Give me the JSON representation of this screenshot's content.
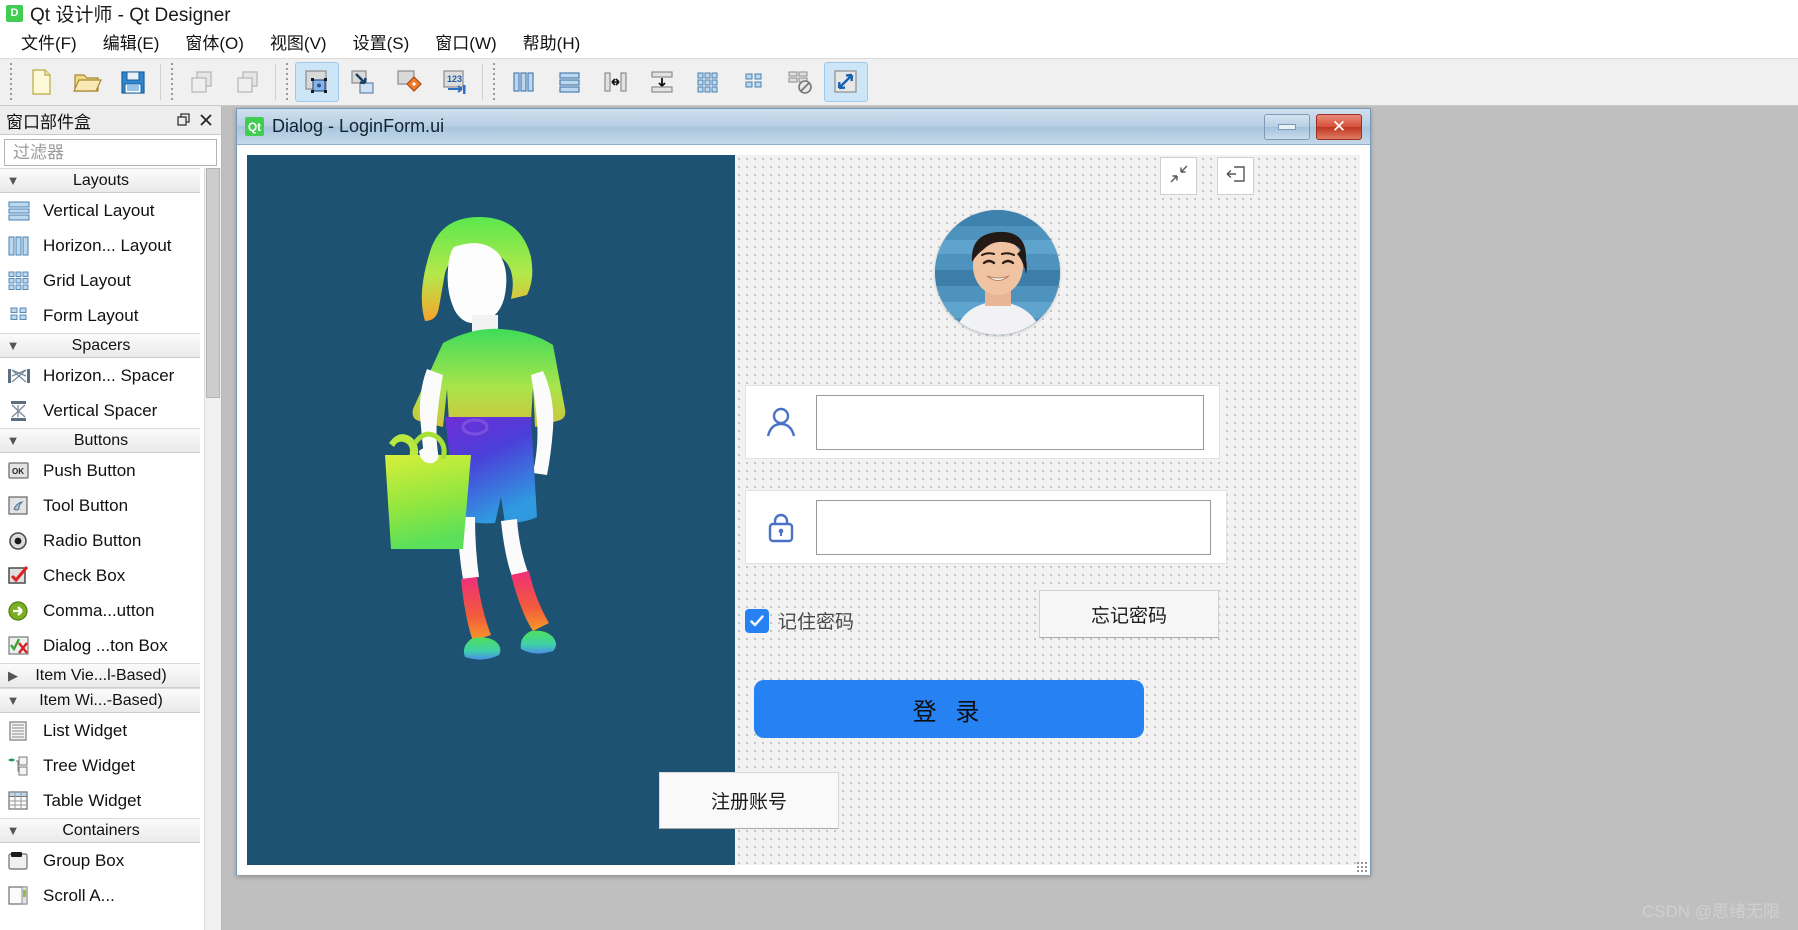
{
  "app": {
    "title": "Qt 设计师 - Qt Designer",
    "logo_text": "D",
    "menus": [
      {
        "label": "文件(F)",
        "name": "menu-file"
      },
      {
        "label": "编辑(E)",
        "name": "menu-edit"
      },
      {
        "label": "窗体(O)",
        "name": "menu-form"
      },
      {
        "label": "视图(V)",
        "name": "menu-view"
      },
      {
        "label": "设置(S)",
        "name": "menu-settings"
      },
      {
        "label": "窗口(W)",
        "name": "menu-window"
      },
      {
        "label": "帮助(H)",
        "name": "menu-help"
      }
    ]
  },
  "toolbar": {
    "groups": [
      [
        "new-file-icon",
        "open-folder-icon",
        "save-icon"
      ],
      [
        "undo-icon",
        "redo-icon"
      ],
      [
        "edit-widgets-icon",
        "edit-signals-slots-icon",
        "edit-buddies-icon",
        "edit-tab-order-icon"
      ],
      [
        "layout-horizontally-icon",
        "layout-vertically-icon",
        "layout-splitter-horizontal-icon",
        "layout-splitter-vertical-icon",
        "layout-grid-icon",
        "layout-form-icon",
        "break-layout-icon",
        "adjust-size-icon"
      ]
    ]
  },
  "dock": {
    "title": "窗口部件盒",
    "float_icon": "float-icon",
    "close_icon": "close-icon",
    "filter_placeholder": "过滤器",
    "filter_value": "",
    "categories": [
      {
        "label": "Layouts",
        "expanded": true,
        "arrow": "chevron-down-icon",
        "items": [
          {
            "label": "Vertical Layout",
            "icon": "vertical-layout-icon"
          },
          {
            "label": "Horizon... Layout",
            "icon": "horizontal-layout-icon"
          },
          {
            "label": "Grid Layout",
            "icon": "grid-layout-icon"
          },
          {
            "label": "Form Layout",
            "icon": "form-layout-icon"
          }
        ]
      },
      {
        "label": "Spacers",
        "expanded": true,
        "arrow": "chevron-down-icon",
        "items": [
          {
            "label": "Horizon... Spacer",
            "icon": "horizontal-spacer-icon"
          },
          {
            "label": "Vertical Spacer",
            "icon": "vertical-spacer-icon"
          }
        ]
      },
      {
        "label": "Buttons",
        "expanded": true,
        "arrow": "chevron-down-icon",
        "items": [
          {
            "label": "Push Button",
            "icon": "push-button-icon"
          },
          {
            "label": "Tool Button",
            "icon": "tool-button-icon"
          },
          {
            "label": "Radio Button",
            "icon": "radio-button-icon"
          },
          {
            "label": "Check Box",
            "icon": "check-box-icon"
          },
          {
            "label": "Comma...utton",
            "icon": "command-link-button-icon"
          },
          {
            "label": "Dialog ...ton Box",
            "icon": "dialog-button-box-icon"
          }
        ]
      },
      {
        "label": "Item Vie...l-Based)",
        "expanded": false,
        "arrow": "chevron-right-icon",
        "items": []
      },
      {
        "label": "Item Wi...-Based)",
        "expanded": true,
        "arrow": "chevron-down-icon",
        "items": [
          {
            "label": "List Widget",
            "icon": "list-widget-icon"
          },
          {
            "label": "Tree Widget",
            "icon": "tree-widget-icon"
          },
          {
            "label": "Table Widget",
            "icon": "table-widget-icon"
          }
        ]
      },
      {
        "label": "Containers",
        "expanded": true,
        "arrow": "chevron-down-icon",
        "items": [
          {
            "label": "Group Box",
            "icon": "group-box-icon"
          },
          {
            "label": "Scroll A...",
            "icon": "scroll-area-icon"
          }
        ]
      }
    ]
  },
  "form": {
    "logo_text": "Qt",
    "title": "Dialog - LoginForm.ui",
    "minimize_label": "minimize-button",
    "close_label": "✕",
    "illustration": {
      "name": "shopping-woman-illustration",
      "background": "#1d5272"
    },
    "top_buttons": [
      {
        "name": "minimize-form-button",
        "icon": "collapse-arrows-icon"
      },
      {
        "name": "exit-form-button",
        "icon": "exit-door-icon"
      }
    ],
    "avatar": {
      "name": "user-avatar",
      "alt": "avatar"
    },
    "fields": [
      {
        "name": "username-field",
        "icon": "user-icon",
        "value": "",
        "placeholder": ""
      },
      {
        "name": "password-field",
        "icon": "lock-icon",
        "value": "",
        "placeholder": ""
      }
    ],
    "remember": {
      "label": "记住密码",
      "checked": true,
      "check_glyph": "✔"
    },
    "forgot_label": "忘记密码",
    "login_label": "登 录",
    "register_label": "注册账号",
    "accent_color": "#2681f2",
    "icon_color": "#4a72c4"
  },
  "watermark": "CSDN @思绪无限"
}
